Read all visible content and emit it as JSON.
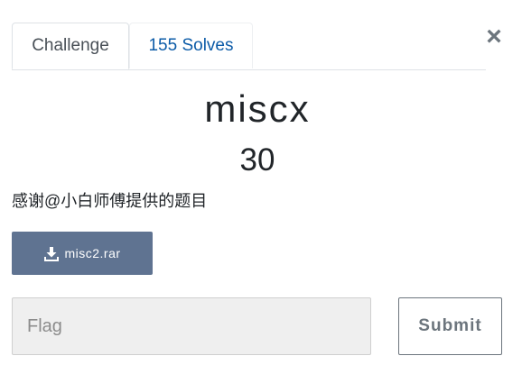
{
  "tabs": [
    {
      "label": "Challenge",
      "active": true
    },
    {
      "label": "155 Solves",
      "active": false
    }
  ],
  "close_label": "×",
  "challenge": {
    "name": "miscx",
    "points": "30",
    "description": "感谢@小白师傅提供的题目"
  },
  "file": {
    "label": "misc2.rar",
    "icon": "download-icon"
  },
  "flag_input": {
    "value": "",
    "placeholder": "Flag"
  },
  "submit_label": "Submit",
  "colors": {
    "file_button": "#5f7391",
    "tab_link": "#0d5ca8",
    "input_bg": "#efefef"
  }
}
